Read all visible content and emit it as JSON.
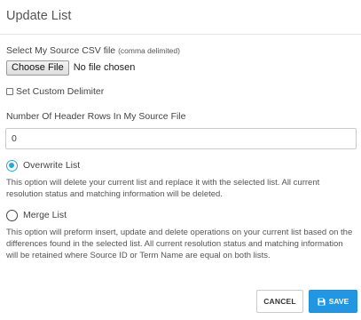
{
  "dialog": {
    "title": "Update List"
  },
  "source_file": {
    "label": "Select My Source CSV file",
    "label_note": "(comma delimited)",
    "choose_button": "Choose File",
    "status": "No file chosen"
  },
  "delimiter": {
    "label": "Set Custom Delimiter",
    "checked": false
  },
  "header_rows": {
    "label": "Number Of Header Rows In My Source File",
    "value": "0"
  },
  "options": {
    "overwrite": {
      "label": "Overwrite List",
      "selected": true,
      "description": "This option will delete your current list and replace it with the selected list. All current resolution status and matching information will be deleted."
    },
    "merge": {
      "label": "Merge List",
      "selected": false,
      "description": "This option will preform insert, update and delete operations on your current list based on the differences found in the selected list. All current resolution status and matching information will be retained where Source ID or Term Name are equal on both lists."
    }
  },
  "footer": {
    "cancel_label": "CANCEL",
    "save_label": "SAVE"
  },
  "colors": {
    "accent": "#2aa6d9",
    "save_button": "#2196e3"
  },
  "icons": {
    "save": "floppy-disk-icon"
  }
}
